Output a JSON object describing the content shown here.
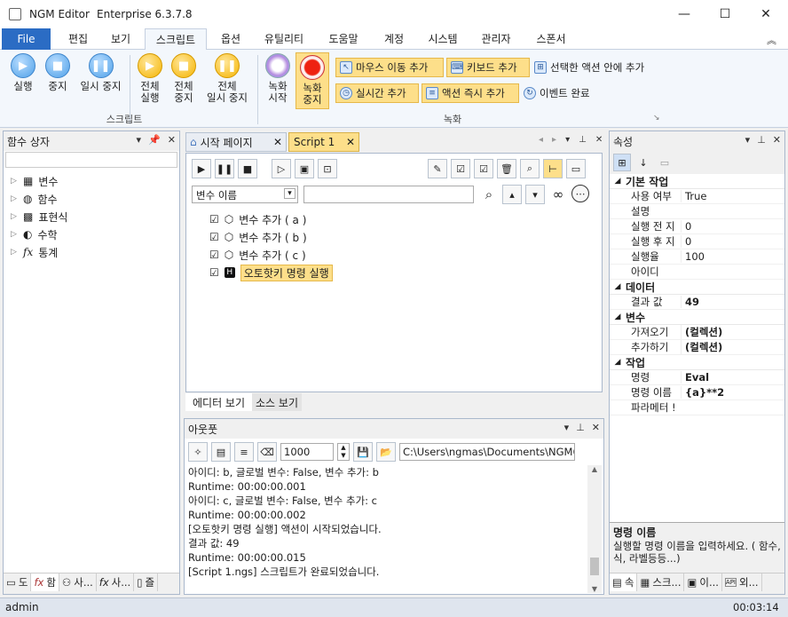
{
  "title": {
    "app": "NGM Editor",
    "edition": "Enterprise 6.3.7.8"
  },
  "window_controls": {
    "minimize": "—",
    "maximize": "☐",
    "close": "✕"
  },
  "menu": [
    "File",
    "편집",
    "보기",
    "스크립트",
    "옵션",
    "유틸리티",
    "도움말",
    "계정",
    "시스템",
    "관리자",
    "스폰서"
  ],
  "ribbon": {
    "script_group": {
      "label": "스크립트",
      "run": "실행",
      "stop": "중지",
      "pause": "일시 중지",
      "run_all_1": "전체",
      "run_all_2": "실행",
      "stop_all_1": "전체",
      "stop_all_2": "중지",
      "pause_all_1": "전체",
      "pause_all_2": "일시 중지"
    },
    "record_group": {
      "label": "녹화",
      "record_start_1": "녹화",
      "record_start_2": "시작",
      "record_stop_1": "녹화",
      "record_stop_2": "중지",
      "mouse_move": "마우스 이동 추가",
      "keyboard": "키보드 추가",
      "add_in_selected": "선택한 액션 안에 추가",
      "realtime": "실시간 추가",
      "instant_action": "액션 즉시 추가",
      "event_done": "이벤트 완료"
    }
  },
  "left_panel": {
    "title": "함수 상자",
    "items": [
      "변수",
      "함수",
      "표현식",
      "수학",
      "통계"
    ],
    "bottom_tabs": [
      "도",
      "함",
      "사...",
      "사...",
      "즐"
    ]
  },
  "editor": {
    "tabs": [
      "시작 페이지",
      "Script 1"
    ],
    "variable_select": "변수 이름",
    "search_value": "",
    "actions": [
      {
        "label": "변수 추가 ( a )",
        "checked": true
      },
      {
        "label": "변수 추가 ( b )",
        "checked": true
      },
      {
        "label": "변수 추가 ( c )",
        "checked": true
      },
      {
        "label": "오토핫키 명령 실행",
        "checked": true
      }
    ],
    "bottom_tabs": [
      "에디터 보기",
      "소스 보기"
    ]
  },
  "output": {
    "title": "아웃풋",
    "count": "1000",
    "path": "C:\\Users\\ngmas\\Documents\\NGM6\\",
    "lines": [
      "아이디: b, 글로벌 변수: False, 변수 추가: b",
      "Runtime: 00:00:00.001",
      "아이디: c, 글로벌 변수: False, 변수 추가: c",
      "Runtime: 00:00:00.002",
      "[오토핫키 명령 실행] 액션이 시작되었습니다.",
      "결과 값: 49",
      "Runtime: 00:00:00.015",
      "[Script 1.ngs] 스크립트가 완료되었습니다."
    ]
  },
  "properties": {
    "title": "속성",
    "categories": [
      {
        "name": "기본 작업",
        "rows": [
          [
            "사용 여부",
            "True"
          ],
          [
            "설명",
            ""
          ],
          [
            "실행 전 지",
            "0"
          ],
          [
            "실행 후 지",
            "0"
          ],
          [
            "실행율",
            "100"
          ],
          [
            "아이디",
            ""
          ]
        ]
      },
      {
        "name": "데이터",
        "rows": [
          [
            "결과 값",
            "49"
          ]
        ]
      },
      {
        "name": "변수",
        "rows": [
          [
            "가져오기",
            "(컬렉션)"
          ],
          [
            "추가하기",
            "(컬렉션)"
          ]
        ]
      },
      {
        "name": "작업",
        "rows": [
          [
            "명령",
            "Eval"
          ],
          [
            "명령 이름",
            "{a}**2"
          ],
          [
            "파라메터 !",
            ""
          ]
        ]
      }
    ],
    "desc_title": "명령 이름",
    "desc_text": "실행할 명령 이름을 입력하세요. ( 함수, 식, 라벨등등...)",
    "bottom_tabs": [
      "속",
      "스크...",
      "이...",
      "외..."
    ]
  },
  "status": {
    "user": "admin",
    "time": "00:03:14"
  }
}
